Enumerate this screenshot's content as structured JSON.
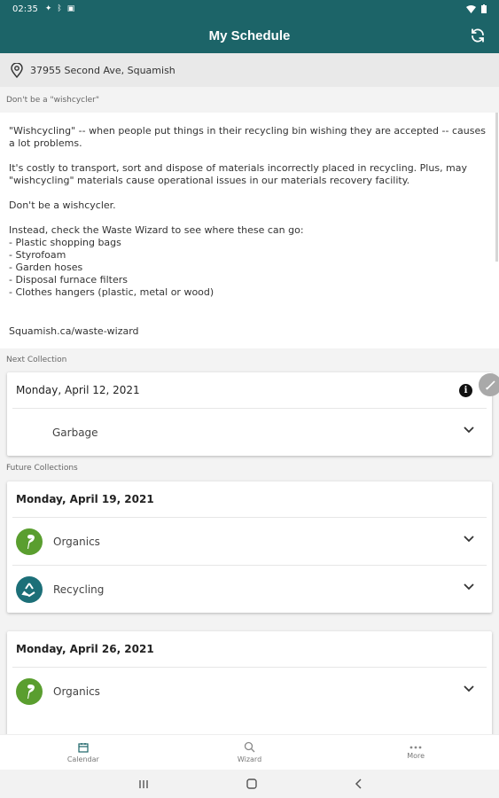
{
  "status": {
    "time": "02:35"
  },
  "header": {
    "title": "My Schedule"
  },
  "address": "37955 Second Ave, Squamish",
  "message": {
    "section_label": "Don't be a \"wishcycler\"",
    "para1": "\"Wishcycling\" -- when people put things in their recycling bin wishing they are accepted -- causes a lot problems.",
    "para2": "It's costly to transport, sort and dispose of materials incorrectly placed in recycling. Plus, may \"wishcycling\" materials cause operational issues in our materials recovery facility.",
    "para3": "Don't be a wishcycler.",
    "para4_intro": "Instead, check the Waste Wizard to see where these can go:",
    "items": [
      "- Plastic shopping bags",
      "- Styrofoam",
      "- Garden hoses",
      "- Disposal furnace filters",
      "- Clothes hangers (plastic, metal or wood)"
    ],
    "link": "Squamish.ca/waste-wizard"
  },
  "next_collection": {
    "section_label": "Next Collection",
    "date": "Monday, April 12, 2021",
    "item": "Garbage"
  },
  "future_collections": {
    "section_label": "Future Collections",
    "groups": [
      {
        "date": "Monday, April 19, 2021",
        "items": [
          {
            "label": "Organics",
            "icon": "organics-leaf-icon",
            "color": "#5a9e2f"
          },
          {
            "label": "Recycling",
            "icon": "recycling-icon",
            "color": "#1c6f78"
          }
        ]
      },
      {
        "date": "Monday, April 26, 2021",
        "items": [
          {
            "label": "Organics",
            "icon": "organics-leaf-icon",
            "color": "#5a9e2f"
          }
        ]
      }
    ]
  },
  "bottom_nav": {
    "tabs": [
      {
        "label": "Calendar",
        "icon": "calendar-icon"
      },
      {
        "label": "Wizard",
        "icon": "wizard-search-icon"
      },
      {
        "label": "More",
        "icon": "more-icon"
      }
    ]
  },
  "colors": {
    "primary": "#1c6468",
    "organics": "#5a9e2f",
    "recycling": "#1c6f78"
  }
}
